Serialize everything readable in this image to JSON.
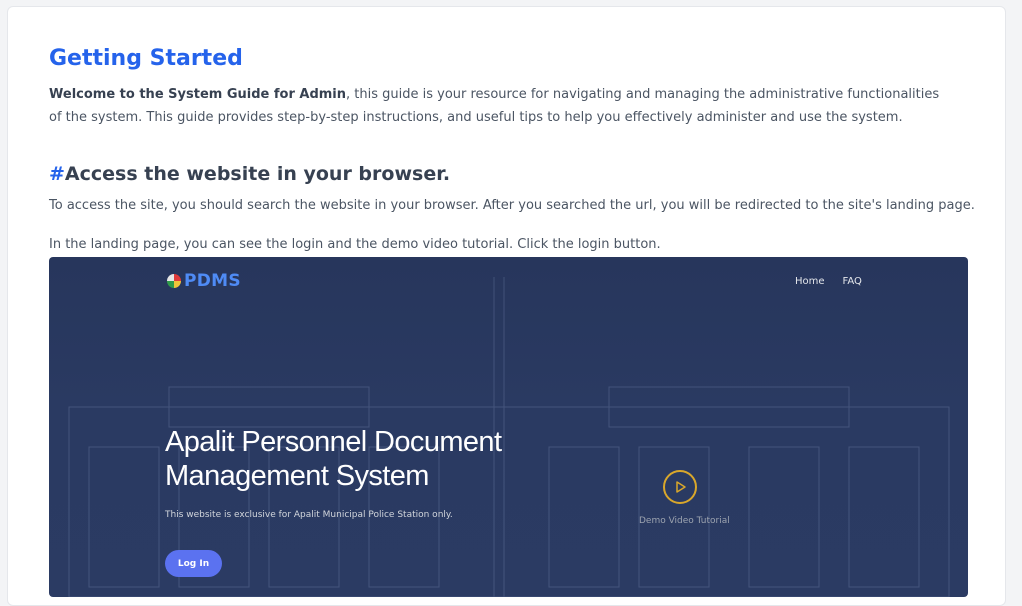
{
  "guide": {
    "title": "Getting Started",
    "intro_bold": "Welcome to the System Guide for Admin",
    "intro_rest": ", this guide is your resource for navigating and managing the administrative functionalities of the system. This guide provides step-by-step instructions, and useful tips to help you effectively administer and use the system.",
    "section": {
      "hash": "#",
      "title": "Access the website in your browser.",
      "para1": "To access the site, you should search the website in your browser. After you searched the url, you will be redirected to the site's landing page.",
      "para2": "In the landing page, you can see the login and the demo video tutorial. Click the login button."
    }
  },
  "screenshot": {
    "brand": "PDMS",
    "nav": [
      "Home",
      "FAQ"
    ],
    "hero_title_line1": "Apalit Personnel Document",
    "hero_title_line2": "Management System",
    "hero_subtitle": "This website is exclusive for Apalit Municipal Police Station only.",
    "login_label": "Log In",
    "demo_label": "Demo Video Tutorial"
  },
  "colors": {
    "accent": "#2563eb",
    "hero_bg": "#2a3a62",
    "login_button": "#5b72f0",
    "play_ring": "#d9a72b"
  }
}
